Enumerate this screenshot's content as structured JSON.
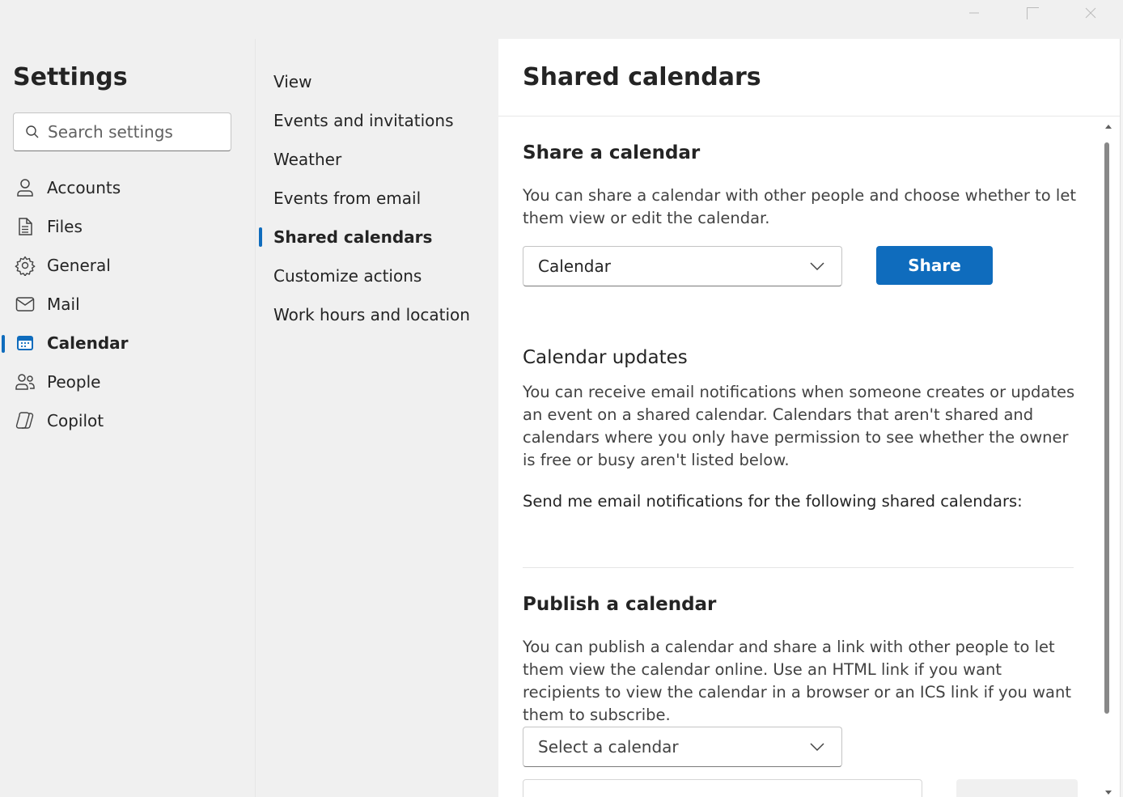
{
  "window": {
    "minimize_icon": "minimize-icon",
    "maximize_icon": "maximize-icon",
    "close_icon": "close-icon"
  },
  "sidebar": {
    "title": "Settings",
    "search_placeholder": "Search settings",
    "items": [
      {
        "label": "Accounts",
        "icon": "person-icon",
        "active": false
      },
      {
        "label": "Files",
        "icon": "document-icon",
        "active": false
      },
      {
        "label": "General",
        "icon": "gear-icon",
        "active": false
      },
      {
        "label": "Mail",
        "icon": "mail-icon",
        "active": false
      },
      {
        "label": "Calendar",
        "icon": "calendar-icon",
        "active": true
      },
      {
        "label": "People",
        "icon": "people-icon",
        "active": false
      },
      {
        "label": "Copilot",
        "icon": "copilot-icon",
        "active": false
      }
    ]
  },
  "subnav": {
    "items": [
      {
        "label": "View",
        "active": false
      },
      {
        "label": "Events and invitations",
        "active": false
      },
      {
        "label": "Weather",
        "active": false
      },
      {
        "label": "Events from email",
        "active": false
      },
      {
        "label": "Shared calendars",
        "active": true
      },
      {
        "label": "Customize actions",
        "active": false
      },
      {
        "label": "Work hours and location",
        "active": false
      }
    ]
  },
  "main": {
    "title": "Shared calendars",
    "share": {
      "heading": "Share a calendar",
      "description": "You can share a calendar with other people and choose whether to let them view or edit the calendar.",
      "dropdown_value": "Calendar",
      "button_label": "Share"
    },
    "updates": {
      "heading": "Calendar updates",
      "description": "You can receive email notifications when someone creates or updates an event on a shared calendar. Calendars that aren't shared and calendars where you only have permission to see whether the owner is free or busy aren't listed below.",
      "notify_label": "Send me email notifications for the following shared calendars:"
    },
    "publish": {
      "heading": "Publish a calendar",
      "description": "You can publish a calendar and share a link with other people to let them view the calendar online. Use an HTML link if you want recipients to view the calendar in a browser or an ICS link if you want them to subscribe.",
      "dropdown_placeholder": "Select a calendar"
    }
  },
  "colors": {
    "accent": "#0f6cbd",
    "background": "#f0f0f0",
    "panel": "#ffffff"
  }
}
